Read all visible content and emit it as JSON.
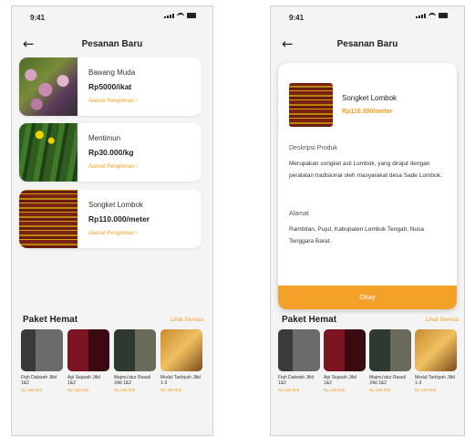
{
  "status": {
    "time": "9:41"
  },
  "header": {
    "title": "Pesanan Baru"
  },
  "orders": [
    {
      "name": "Bawang Muda",
      "price": "Rp5000/ikat",
      "link": "Alamat Pengiriman ›"
    },
    {
      "name": "Mentimun",
      "price": "Rp30.000/kg",
      "link": "Alamat Pengiriman ›"
    },
    {
      "name": "Songket Lombok",
      "price": "Rp110.000/meter",
      "link": "Alamat Pengiriman ›"
    }
  ],
  "paket": {
    "title": "Paket Hemat",
    "see_all": "Lihat Semua",
    "books": [
      {
        "title": "Fiqh Dakwah Jilid 1&2",
        "price": "Rp 180.000"
      },
      {
        "title": "Api Sejarah Jilid 1&2",
        "price": "Rp 180.000"
      },
      {
        "title": "Majmu'atur Rasail Jilid 1&2",
        "price": "Rp 180.000"
      },
      {
        "title": "Modul Tarbiyah Jilid 1-3",
        "price": "Rp 180.000"
      }
    ]
  },
  "modal": {
    "name": "Songket Lombok",
    "price": "Rp110.000/meter",
    "desc_label": "Deskripsi Produk",
    "desc_text": "Merupakan songket asli Lombok, yang dirajut dengan peralatan tradisional oleh masyarakat desa Sade Lombok.",
    "addr_label": "Alamat",
    "addr_text": "Rambitan, Pujut, Kabupaten Lombok Tengah, Nusa Tenggara Barat.",
    "okay": "Okay"
  },
  "colors": {
    "accent": "#f4a12a",
    "background": "#f4f4f4"
  }
}
